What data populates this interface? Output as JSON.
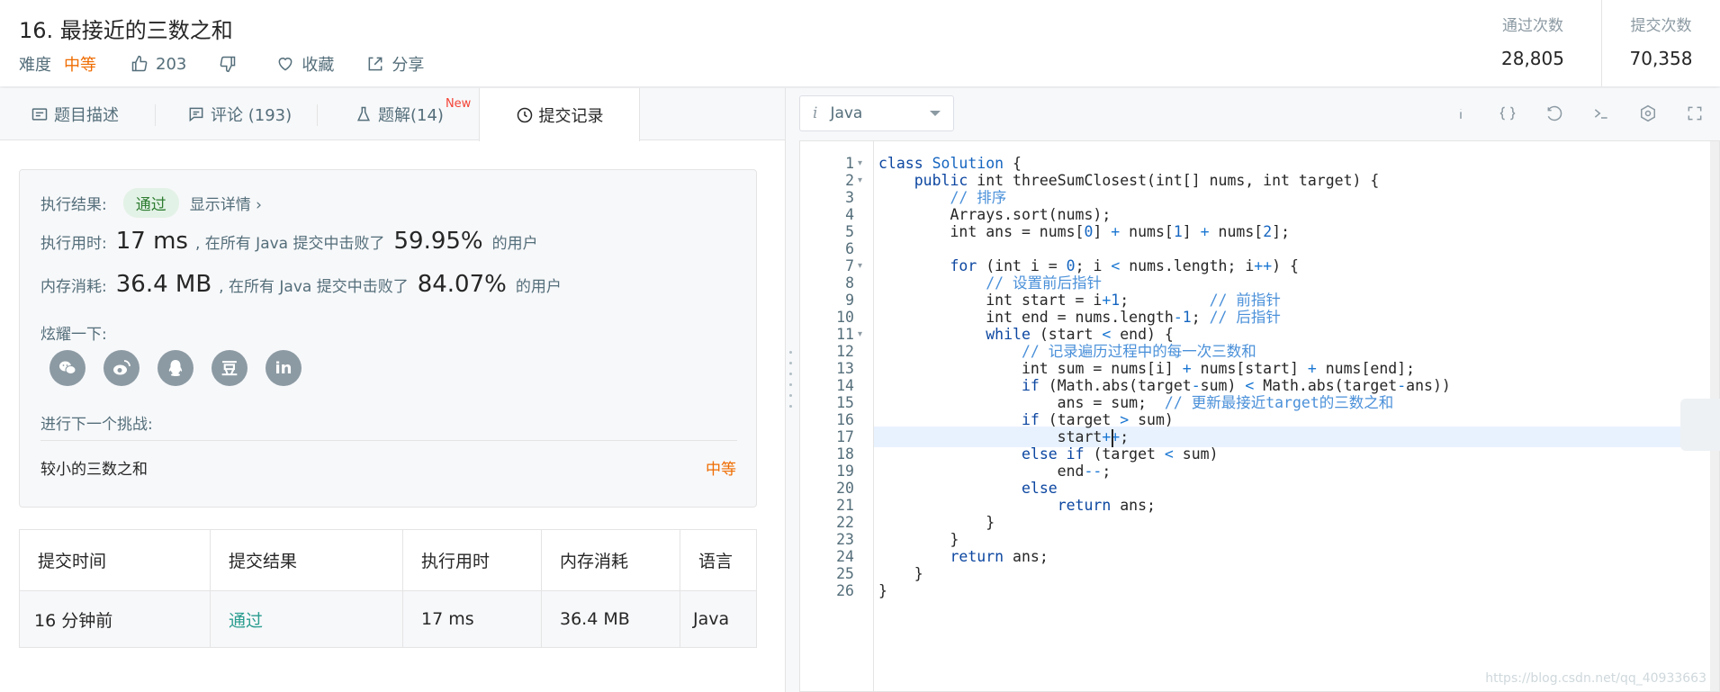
{
  "header": {
    "title": "16. 最接近的三数之和",
    "difficulty_label": "难度",
    "difficulty_value": "中等",
    "likes": "203",
    "favorite_label": "收藏",
    "share_label": "分享",
    "stats": [
      {
        "label": "通过次数",
        "value": "28,805"
      },
      {
        "label": "提交次数",
        "value": "70,358"
      }
    ]
  },
  "tabs": [
    {
      "label": "题目描述"
    },
    {
      "label": "评论 (193)"
    },
    {
      "label": "题解(14)",
      "badge": "New"
    },
    {
      "label": "提交记录"
    }
  ],
  "result": {
    "exec_result_label": "执行结果:",
    "status": "通过",
    "details_link": "显示详情 ›",
    "time_label": "执行用时:",
    "time_value": "17 ms",
    "time_mid": ", 在所有 Java 提交中击败了",
    "time_pct": "59.95%",
    "time_tail": "的用户",
    "mem_label": "内存消耗:",
    "mem_value": "36.4 MB",
    "mem_mid": ", 在所有 Java 提交中击败了",
    "mem_pct": "84.07%",
    "mem_tail": "的用户",
    "share_label": "炫耀一下:",
    "share_icons": [
      "wechat-icon",
      "weibo-icon",
      "qq-icon",
      "douban-icon",
      "linkedin-icon"
    ],
    "douban_glyph": "豆",
    "linkedin_glyph": "in",
    "next_label": "进行下一个挑战:",
    "next_name": "较小的三数之和",
    "next_diff": "中等"
  },
  "submissions": {
    "headers": [
      "提交时间",
      "提交结果",
      "执行用时",
      "内存消耗",
      "语言"
    ],
    "rows": [
      [
        "16 分钟前",
        "通过",
        "17 ms",
        "36.4 MB",
        "Java"
      ]
    ]
  },
  "editor": {
    "language": "Java",
    "lang_prefix": "i",
    "watermark": "https://blog.csdn.net/qq_40933663",
    "line_numbers": [
      "1",
      "2",
      "3",
      "4",
      "5",
      "6",
      "7",
      "8",
      "9",
      "10",
      "11",
      "12",
      "13",
      "14",
      "15",
      "16",
      "17",
      "18",
      "19",
      "20",
      "21",
      "22",
      "23",
      "24",
      "25",
      "26"
    ],
    "folds": {
      "1": true,
      "2": true,
      "7": true,
      "11": true
    },
    "highlighted_line": 17
  },
  "colors": {
    "accent_orange": "#ef6c00",
    "pass_green": "#2e7d32",
    "link_teal": "#2a9d8f"
  }
}
